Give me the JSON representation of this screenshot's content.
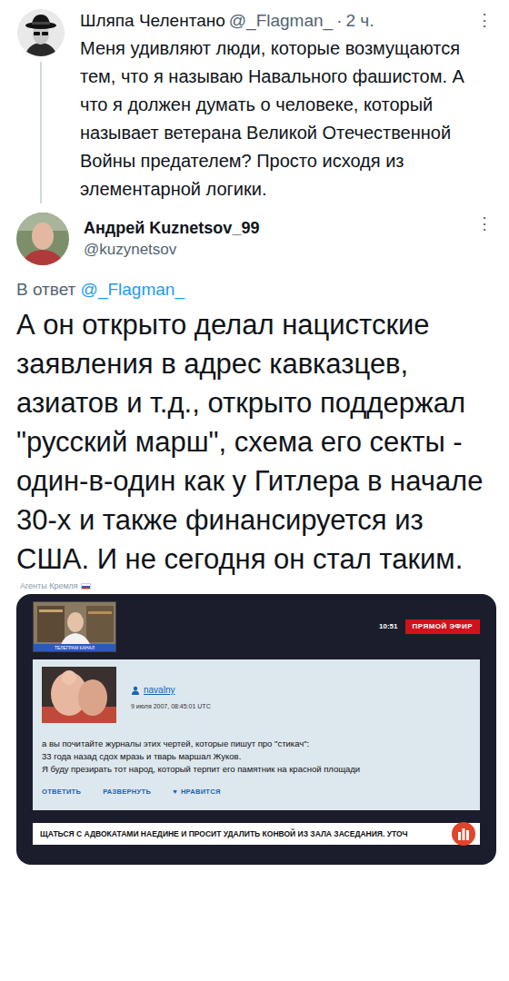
{
  "parent_tweet": {
    "author": {
      "name": "Шляпа Челентано",
      "handle": "@_Flagman_"
    },
    "separator": "·",
    "time": "2 ч.",
    "menu": "⋮",
    "text": "Меня удивляют люди, которые возмущаются тем, что я называю Навального фашистом. А что я должен думать о человеке, который называет ветерана Великой Отечественной Войны предателем? Просто исходя из элементарной логики."
  },
  "reply_tweet": {
    "author": {
      "name": "Андрей Kuznetsov_99",
      "handle": "@kuzynetsov"
    },
    "menu": "⋮",
    "reply_to_label": "В ответ",
    "reply_to_handle": "@_Flagman_",
    "text": "А он открыто делал нацистские заявления в адрес кавказцев, азиатов и т.д., открыто поддержал \"русский марш\", схема его секты - один-в-один как у Гитлера в начале 30-х и также финансируется из США. И не сегодня он стал таким.",
    "media": {
      "source": "Агенты Кремля",
      "webcam_label": "ТЕЛЕГРАМ КАНАЛ",
      "clock": "10:51",
      "live_badge": "ПРЯМОЙ ЭФИР",
      "comment": {
        "user": "navalny",
        "date": "9 июля 2007, 08:45:01 UTC",
        "lines": [
          "а вы почитайте журналы этих чертей, которые пишут про \"стикач\":",
          "33 года назад сдох мразь и тварь маршал Жуков.",
          "Я буду презирать тот народ, который терпит его памятник на красной площади"
        ],
        "actions": [
          "ОТВЕТИТЬ",
          "РАЗВЕРНУТЬ"
        ],
        "like": {
          "icon": "♥",
          "label": "НРАВИТСЯ"
        }
      },
      "ticker": "ЩАТЬСЯ С АДВОКАТАМИ НАЕДИНЕ И ПРОСИТ УДАЛИТЬ КОНВОЙ ИЗ ЗАЛА ЗАСЕДАНИЯ. УТОЧ"
    }
  }
}
